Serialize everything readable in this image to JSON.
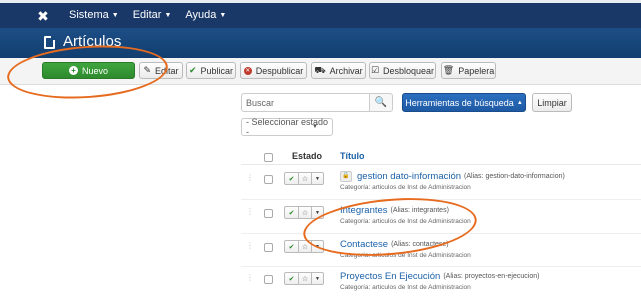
{
  "topbar": {
    "logo_icon": "joomla-icon",
    "menu": [
      {
        "label": "Sistema"
      },
      {
        "label": "Editar"
      },
      {
        "label": "Ayuda"
      }
    ]
  },
  "header": {
    "title": "Artículos",
    "icon": "article-icon"
  },
  "toolbar": {
    "new_label": "Nuevo",
    "edit_label": "Editar",
    "publish_label": "Publicar",
    "unpublish_label": "Despublicar",
    "archive_label": "Archivar",
    "unlock_label": "Desbloquear",
    "trash_label": "Papelera"
  },
  "filters": {
    "search_placeholder": "Buscar",
    "search_tools_label": "Herramientas de búsqueda",
    "clear_label": "Limpiar",
    "state_select": "- Seleccionar estado -"
  },
  "table": {
    "col_status": "Estado",
    "col_title": "Título",
    "rows": [
      {
        "title": "gestion dato-información",
        "alias": "(Alias: gestion-dato-informacion)",
        "category": "Categoría: articulos de Inst de Administracion",
        "locked": true
      },
      {
        "title": "Integrantes",
        "alias": "(Alias: integrantes)",
        "category": "Categoría: articulos de Inst de Administracion",
        "locked": false
      },
      {
        "title": "Contactese",
        "alias": "(Alias: contactese)",
        "category": "Categoría: articulos de Inst de Administracion",
        "locked": false
      },
      {
        "title": "Proyectos En Ejecución",
        "alias": "(Alias: proyectos-en-ejecucion)",
        "category": "Categoría: articulos de Inst de Administracion",
        "locked": false
      }
    ]
  },
  "colors": {
    "topbar": "#1a3867",
    "header": "#17467a",
    "new_button": "#3a9a3a",
    "primary_button": "#2566b3",
    "link": "#1c61a9",
    "annotation": "#e66b1f"
  }
}
